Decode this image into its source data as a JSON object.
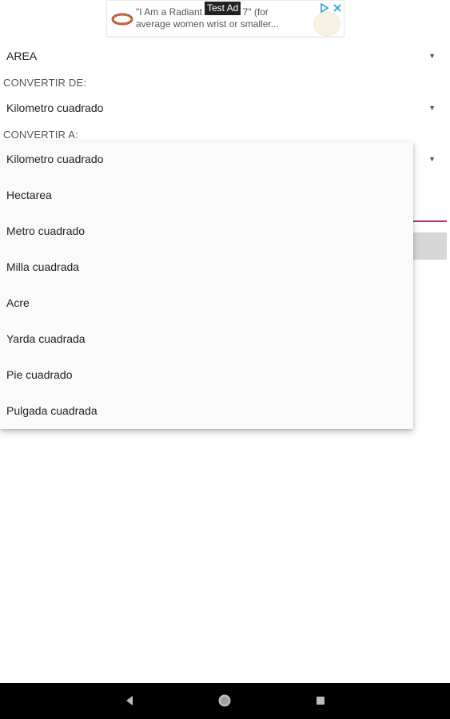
{
  "ad": {
    "label": "Test Ad",
    "text": "\"I Am a Radiant Bracelet 7\" (for\naverage women wrist or smaller..."
  },
  "category": {
    "selected": "AREA"
  },
  "convert_from": {
    "label": "CONVERTIR DE:",
    "selected": "Kilometro cuadrado"
  },
  "convert_to": {
    "label": "CONVERTIR A:"
  },
  "dropdown": {
    "options": [
      "Kilometro cuadrado",
      "Hectarea",
      "Metro cuadrado",
      "Milla cuadrada",
      "Acre",
      "Yarda cuadrada",
      "Pie cuadrado",
      "Pulgada cuadrada"
    ]
  },
  "colors": {
    "accent": "#d81b60",
    "navbar": "#000000",
    "popup_bg": "#fafafa"
  },
  "icons": {
    "dropdown_caret": "caret-down-icon",
    "nav": [
      "back-triangle-icon",
      "home-circle-icon",
      "recents-square-icon"
    ],
    "ad": [
      "ad-choices-icon",
      "close-icon"
    ]
  }
}
